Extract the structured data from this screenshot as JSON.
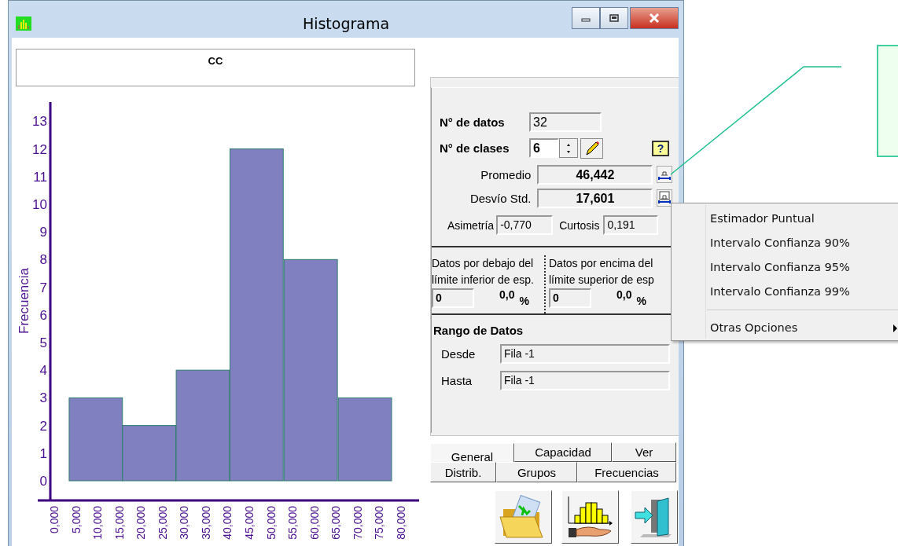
{
  "window": {
    "title": "Histograma"
  },
  "chart_header": "CC",
  "chart": {
    "chart_data": {
      "type": "bar",
      "ylabel": "Frecuencia",
      "x": [
        9.6,
        21.9,
        34.3,
        46.7,
        59.2,
        71.7
      ],
      "values": [
        3,
        2,
        4,
        12,
        8,
        3
      ],
      "xlim": [
        -3.8,
        84.2
      ],
      "xticks": [
        {
          "value": 0,
          "label": "0,000"
        },
        {
          "value": 5,
          "label": "5,000"
        },
        {
          "value": 10,
          "label": "10,000"
        },
        {
          "value": 15,
          "label": "15,000"
        },
        {
          "value": 20,
          "label": "20,000"
        },
        {
          "value": 25,
          "label": "25,000"
        },
        {
          "value": 30,
          "label": "30,000"
        },
        {
          "value": 35,
          "label": "35,000"
        },
        {
          "value": 40,
          "label": "40,000"
        },
        {
          "value": 45,
          "label": "45,000"
        },
        {
          "value": 50,
          "label": "50,000"
        },
        {
          "value": 55,
          "label": "55,000"
        },
        {
          "value": 60,
          "label": "60,000"
        },
        {
          "value": 65,
          "label": "65,000"
        },
        {
          "value": 70,
          "label": "70,000"
        },
        {
          "value": 75,
          "label": "75,000"
        },
        {
          "value": 80,
          "label": "80,000"
        }
      ],
      "ylim": [
        -0.71,
        13.69
      ],
      "yticks": [
        0,
        1,
        2,
        3,
        4,
        5,
        6,
        7,
        8,
        9,
        10,
        11,
        12,
        13
      ]
    }
  },
  "stats": {
    "n_datos": {
      "label": "N° de datos",
      "value": "32"
    },
    "n_clases": {
      "label": "N° de clases",
      "value": "6"
    },
    "promedio": {
      "label": "Promedio",
      "value": "46,442"
    },
    "desvio": {
      "label": "Desvío Std.",
      "value": "17,601"
    },
    "asimetria": {
      "label": "Asimetría",
      "value": "-0,770"
    },
    "curtosis": {
      "label": "Curtosis",
      "value": "0,191"
    },
    "help": "?"
  },
  "spec": [
    {
      "line1": "Datos por debajo del",
      "line2": "límite inferior de esp.",
      "count": "0",
      "percent": "0,0",
      "unit": "%"
    },
    {
      "line1": "Datos por encima del",
      "line2": "límite superior de esp",
      "count": "0",
      "percent": "0,0",
      "unit": "%"
    }
  ],
  "range": {
    "title": "Rango de Datos",
    "rows": [
      {
        "label": "Desde",
        "value": "Fila -1"
      },
      {
        "label": "Hasta",
        "value": "Fila -1"
      }
    ]
  },
  "tabs": [
    [
      {
        "label": "General",
        "selected": true
      },
      {
        "label": "Capacidad",
        "selected": false
      },
      {
        "label": "Ver",
        "selected": false
      }
    ],
    [
      {
        "label": "Distrib.",
        "selected": false
      },
      {
        "label": "Grupos",
        "selected": false
      },
      {
        "label": "Frecuencias",
        "selected": false
      }
    ]
  ],
  "context_menu": [
    {
      "kind": "item",
      "label": "Estimador Puntual"
    },
    {
      "kind": "item",
      "label": "Intervalo Confianza 90%"
    },
    {
      "kind": "item",
      "label": "Intervalo Confianza 95%"
    },
    {
      "kind": "item",
      "label": "Intervalo Confianza 99%"
    },
    {
      "kind": "separator"
    },
    {
      "kind": "submenu",
      "label": "Otras Opciones"
    }
  ]
}
